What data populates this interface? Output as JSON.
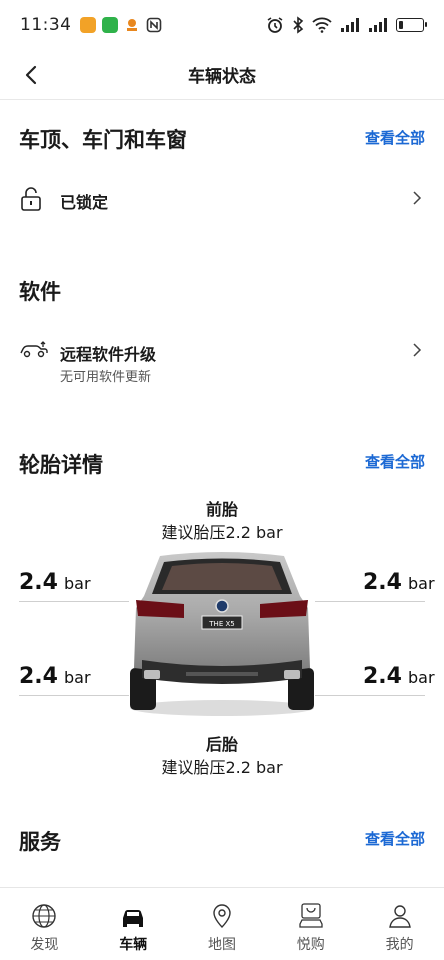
{
  "status_bar": {
    "time": "11:34",
    "battery_level": 0.2
  },
  "header": {
    "title": "车辆状态"
  },
  "doors_section": {
    "title": "车顶、车门和车窗",
    "view_all": "查看全部",
    "status_label": "已锁定",
    "icon": "lock-icon"
  },
  "software_section": {
    "title": "软件",
    "item_label": "远程软件升级",
    "item_sub": "无可用软件更新",
    "icon": "car-upgrade-icon"
  },
  "tire_section": {
    "title": "轮胎详情",
    "view_all": "查看全部",
    "front_heading": "前胎",
    "front_recommend": "建议胎压2.2 bar",
    "rear_heading": "后胎",
    "rear_recommend": "建议胎压2.2 bar",
    "car_plate": "THE X5",
    "front_left": {
      "value": "2.4",
      "unit": "bar"
    },
    "front_right": {
      "value": "2.4",
      "unit": "bar"
    },
    "rear_left": {
      "value": "2.4",
      "unit": "bar"
    },
    "rear_right": {
      "value": "2.4",
      "unit": "bar"
    }
  },
  "service_section": {
    "title": "服务",
    "view_all": "查看全部"
  },
  "tabs": [
    {
      "label": "发现",
      "icon": "globe-icon"
    },
    {
      "label": "车辆",
      "icon": "car-icon",
      "active": true
    },
    {
      "label": "地图",
      "icon": "map-pin-icon"
    },
    {
      "label": "悦购",
      "icon": "shopping-car-icon"
    },
    {
      "label": "我的",
      "icon": "user-icon"
    }
  ]
}
